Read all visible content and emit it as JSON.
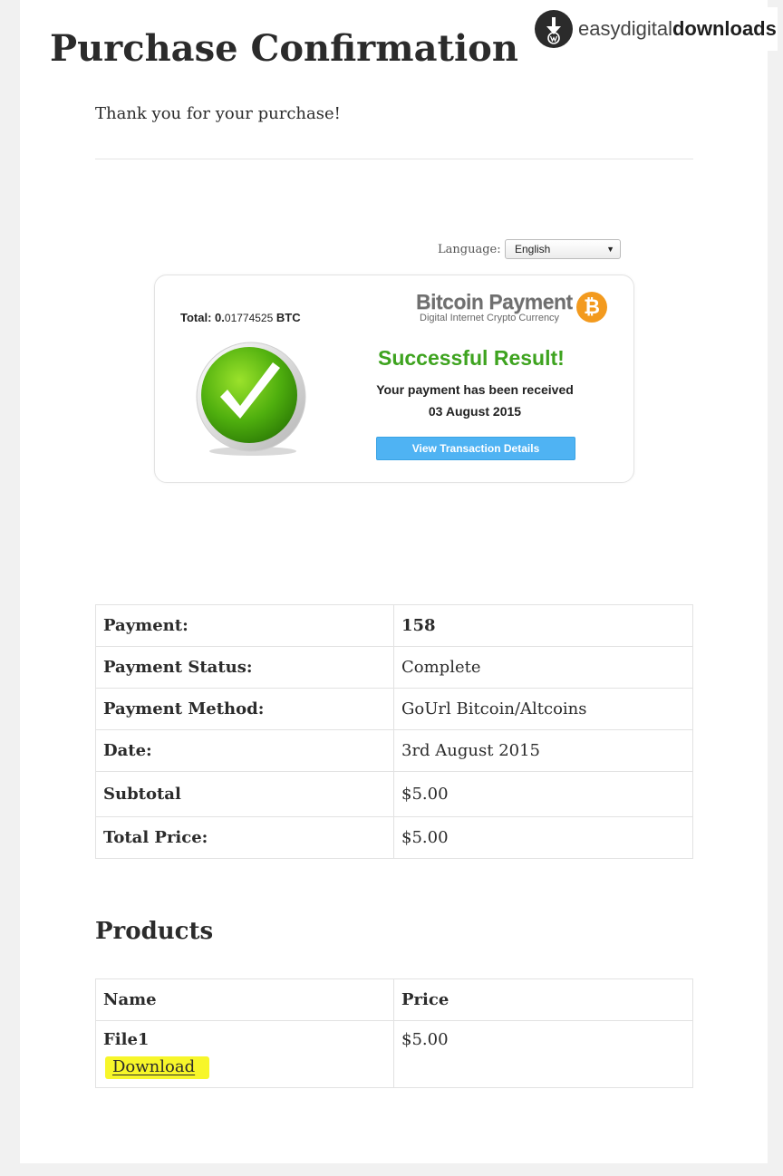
{
  "header": {
    "title": "Purchase Confirmation",
    "logo": {
      "text_regular_1": "easy",
      "text_regular_2": "digital",
      "text_bold": "downloads"
    }
  },
  "message": "Thank you for your purchase!",
  "language": {
    "label": "Language:",
    "selected": "English"
  },
  "bitcoin_box": {
    "total_label": "Total:",
    "total_int": "0.",
    "total_decimals": "01774525",
    "total_currency": "BTC",
    "brand_name": "Bitcoin Payment",
    "brand_sub": "Digital Internet Crypto Currency",
    "coin_symbol": "₿",
    "result_title": "Successful Result!",
    "result_text": "Your payment has been received",
    "result_date": "03 August 2015",
    "view_button": "View Transaction Details",
    "colors": {
      "success": "#3ea31f",
      "button": "#4fb3f3",
      "coin": "#f39a1e"
    }
  },
  "payment_table": [
    {
      "label": "Payment:",
      "value": "158"
    },
    {
      "label": "Payment Status:",
      "value": "Complete"
    },
    {
      "label": "Payment Method:",
      "value": "GoUrl Bitcoin/Altcoins"
    },
    {
      "label": "Date:",
      "value": "3rd August 2015"
    },
    {
      "label": "Subtotal",
      "value": "$5.00"
    },
    {
      "label": "Total Price:",
      "value": "$5.00"
    }
  ],
  "products": {
    "heading": "Products",
    "columns": [
      "Name",
      "Price"
    ],
    "rows": [
      {
        "name": "File1",
        "link": "Download",
        "price": "$5.00"
      }
    ]
  }
}
